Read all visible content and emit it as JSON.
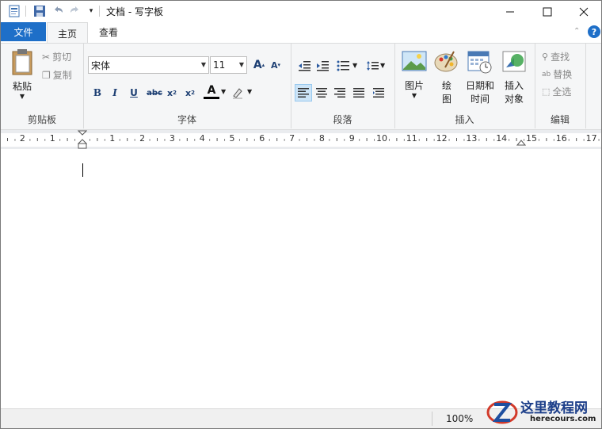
{
  "title_bar": {
    "title": "文档 - 写字板"
  },
  "tabs": {
    "file": "文件",
    "home": "主页",
    "view": "查看"
  },
  "clipboard": {
    "paste": "粘贴",
    "cut": "剪切",
    "copy": "复制",
    "label": "剪贴板"
  },
  "font": {
    "family": "宋体",
    "size": "11",
    "label": "字体"
  },
  "paragraph": {
    "label": "段落"
  },
  "insert": {
    "picture": "图片",
    "paint_line1": "绘",
    "paint_line2": "图",
    "datetime_line1": "日期和",
    "datetime_line2": "时间",
    "object_line1": "插入",
    "object_line2": "对象",
    "label": "插入"
  },
  "editing": {
    "find": "查找",
    "replace": "替换",
    "select_all": "全选",
    "label": "编辑"
  },
  "ruler": {
    "numbers": [
      "2",
      "1",
      "1",
      "2",
      "3",
      "4",
      "5",
      "6",
      "7",
      "8",
      "9",
      "10",
      "11",
      "12",
      "13",
      "14",
      "15",
      "16",
      "17"
    ]
  },
  "status": {
    "zoom": "100%"
  },
  "watermark": {
    "site_name": "这里教程网",
    "site_url": "herecours.com"
  }
}
